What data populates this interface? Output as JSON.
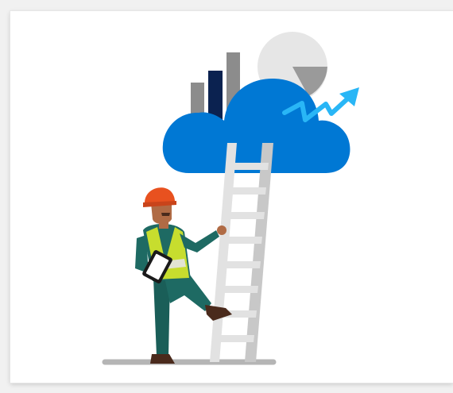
{
  "illustration": {
    "subject": "worker-climbing-ladder-to-cloud",
    "icons": [
      "bar-chart-icon",
      "pie-chart-icon",
      "cloud-icon",
      "trend-arrow-icon",
      "ladder-icon",
      "worker-icon",
      "tablet-icon",
      "hard-hat-icon"
    ],
    "colors": {
      "cloud": "#0078d4",
      "arrow": "#29b6f6",
      "bar_gray": "#8c8c8c",
      "bar_navy": "#0b2250",
      "pie_light": "#e6e6e6",
      "pie_slice": "#9a9a9a",
      "ladder": "#e2e2e2",
      "ladder_shade": "#c8c8c8",
      "hard_hat": "#e8511f",
      "vest": "#c7dd2e",
      "suit": "#1e6a63",
      "skin": "#b06b45",
      "boots": "#4a2a1c",
      "ground": "#b5b5b5"
    }
  }
}
